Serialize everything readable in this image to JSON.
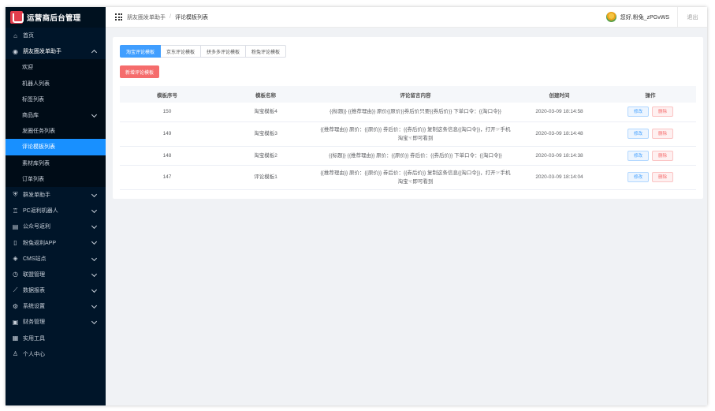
{
  "app": {
    "title": "运营商后台管理"
  },
  "sidebar": {
    "items": [
      {
        "label": "首页",
        "icon": "home-icon",
        "type": "top",
        "chevron": false
      },
      {
        "label": "朋友圈发单助手",
        "icon": "target-icon",
        "type": "open",
        "chevron": "up"
      },
      {
        "label": "欢迎",
        "type": "sub"
      },
      {
        "label": "机器人列表",
        "type": "sub"
      },
      {
        "label": "标签列表",
        "type": "sub"
      },
      {
        "label": "商品库",
        "type": "sub",
        "chevron": "down"
      },
      {
        "label": "发圈任务列表",
        "type": "sub"
      },
      {
        "label": "评论模板列表",
        "type": "sub",
        "active": true
      },
      {
        "label": "素材库列表",
        "type": "sub"
      },
      {
        "label": "订单列表",
        "type": "sub"
      },
      {
        "label": "群发单助手",
        "icon": "shield-icon",
        "type": "top",
        "chevron": "down"
      },
      {
        "label": "PC返利机器人",
        "icon": "robot-icon",
        "type": "top",
        "chevron": "down"
      },
      {
        "label": "公众号返利",
        "icon": "document-icon",
        "type": "top",
        "chevron": "down"
      },
      {
        "label": "粉兔返利APP",
        "icon": "phone-icon",
        "type": "top",
        "chevron": "down"
      },
      {
        "label": "CMS站点",
        "icon": "layers-icon",
        "type": "top",
        "chevron": "down"
      },
      {
        "label": "联盟管理",
        "icon": "clock-icon",
        "type": "top",
        "chevron": "down"
      },
      {
        "label": "数据报表",
        "icon": "chart-icon",
        "type": "top",
        "chevron": "down"
      },
      {
        "label": "系统设置",
        "icon": "gear-icon",
        "type": "top",
        "chevron": "down"
      },
      {
        "label": "财务管理",
        "icon": "wallet-icon",
        "type": "top",
        "chevron": "down"
      },
      {
        "label": "实用工具",
        "icon": "calendar-icon",
        "type": "top",
        "chevron": false
      },
      {
        "label": "个人中心",
        "icon": "user-icon",
        "type": "top",
        "chevron": false
      }
    ]
  },
  "topbar": {
    "breadcrumb": [
      "朋友圈发单助手",
      "评论模板列表"
    ],
    "user_greeting": "您好,粉兔_zPGvWS",
    "logout_label": "退出"
  },
  "tabs": [
    {
      "label": "淘宝评论模板",
      "active": true
    },
    {
      "label": "京东评论模板",
      "active": false
    },
    {
      "label": "拼多多评论模板",
      "active": false
    },
    {
      "label": "粉兔评论模板",
      "active": false
    }
  ],
  "add_button_label": "新增评论模板",
  "table": {
    "headers": [
      "模板序号",
      "模板名称",
      "评论留言内容",
      "创建时间",
      "操作"
    ],
    "edit_label": "修改",
    "delete_label": "删除",
    "rows": [
      {
        "id": "150",
        "name": "淘宝模板4",
        "content": "{{标题}} {{推荐理由}} 原价{{原价}}券后价只要{{券后价}} 下单口令：{{淘口令}}",
        "created": "2020-03-09 18:14:58",
        "tall": false
      },
      {
        "id": "149",
        "name": "淘宝模板3",
        "content": "{{推荐理由}} 原价：{{原价}} 券后价：{{券后价}} 复制这条信息{{淘口令}}，打开☞手机淘宝☜即可看到",
        "created": "2020-03-09 18:14:48",
        "tall": true
      },
      {
        "id": "148",
        "name": "淘宝模板2",
        "content": "{{标题}} {{推荐理由}} 原价：{{原价}} 券后价：{{券后价}} 下单口令：{{淘口令}}",
        "created": "2020-03-09 18:14:38",
        "tall": false
      },
      {
        "id": "147",
        "name": "评论模板1",
        "content": "{{推荐理由}} 原价：{{原价}} 券后价：{{券后价}} 复制这条信息{{淘口令}}，打开☞手机淘宝☜即可看到",
        "created": "2020-03-09 18:14:04",
        "tall": true
      }
    ]
  },
  "colors": {
    "sidebar_bg": "#001529",
    "active": "#1890ff",
    "primary": "#409eff",
    "danger": "#f56c6c"
  }
}
